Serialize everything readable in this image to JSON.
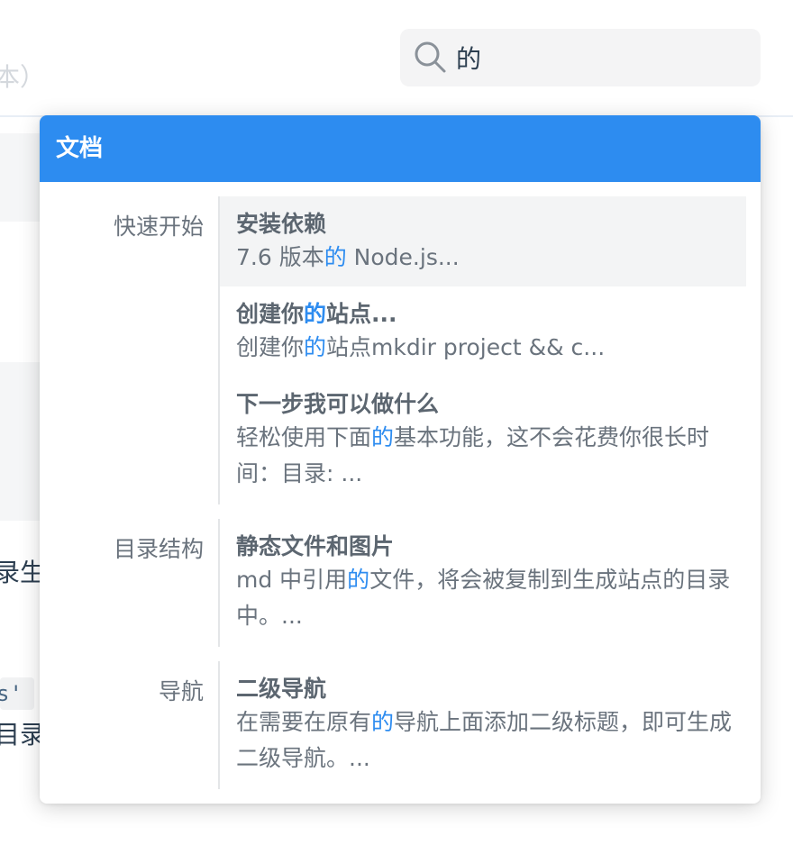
{
  "search": {
    "query": "的"
  },
  "background": {
    "fragment_1": "本）",
    "fragment_2": "录生",
    "fragment_3": "目录",
    "code_snippet": "s'"
  },
  "dropdown": {
    "header": "文档",
    "groups": [
      {
        "label": "快速开始",
        "results": [
          {
            "title": "安装依赖",
            "content_before": "7.6 版本",
            "content_match": "的",
            "content_after": " Node.js..."
          },
          {
            "title_before": "创建你",
            "title_match": "的",
            "title_after": "站点...",
            "content_before": "创建你",
            "content_match": "的",
            "content_after": "站点mkdir project && c..."
          },
          {
            "title": "下一步我可以做什么",
            "content_before": "轻松使用下面",
            "content_match": "的",
            "content_after": "基本功能，这不会花费你很长时间：目录: ..."
          }
        ]
      },
      {
        "label": "目录结构",
        "results": [
          {
            "title": "静态文件和图片",
            "content_before": "md 中引用",
            "content_match": "的",
            "content_after": "文件，将会被复制到生成站点的目录中。..."
          }
        ]
      },
      {
        "label": "导航",
        "results": [
          {
            "title": "二级导航",
            "content_before": "在需要在原有",
            "content_match": "的",
            "content_after": "导航上面添加二级标题，即可生成二级导航。..."
          }
        ]
      }
    ]
  },
  "colors": {
    "accent": "#2d8cf0",
    "title_text": "#5c6670",
    "body_text": "#6a737d"
  }
}
